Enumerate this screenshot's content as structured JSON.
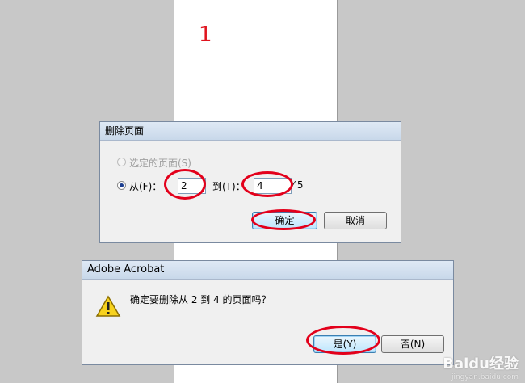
{
  "page": {
    "number": "1"
  },
  "delete_dialog": {
    "title": "删除页面",
    "selected_option_label": "选定的页面(S)",
    "from_label": "从(F)：",
    "from_value": "2",
    "to_label": "到(T)：",
    "to_value": "4",
    "total_pages": "⁄ 5",
    "ok_label": "确定",
    "cancel_label": "取消"
  },
  "confirm_dialog": {
    "title": "Adobe Acrobat",
    "message": "确定要删除从 2 到 4 的页面吗？",
    "yes_label": "是(Y)",
    "no_label": "否(N)",
    "icon": "warning-icon"
  },
  "watermark": {
    "main": "Baidu经验",
    "sub": "jingyan.baidu.com"
  },
  "colors": {
    "annotation": "#e3001b",
    "background": "#c8c8c8",
    "dialog": "#f0f0f0"
  }
}
